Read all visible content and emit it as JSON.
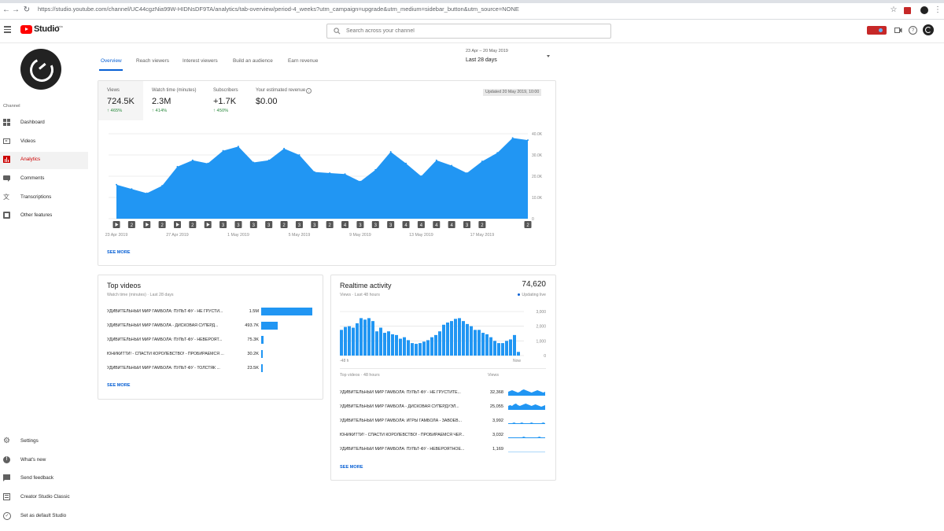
{
  "browser": {
    "url": "https://studio.youtube.com/channel/UC44cgzNia99W-HIDNsDF9TA/analytics/tab-overview/period-4_weeks?utm_campaign=upgrade&utm_medium=sidebar_button&utm_source=NONE"
  },
  "header": {
    "logo_text": "Studio",
    "logo_badge": "beta",
    "search_placeholder": "Search across your channel",
    "accent": "#ff0000"
  },
  "sidebar": {
    "section_label": "Channel",
    "items": [
      {
        "label": "Dashboard",
        "icon": "dashboard-icon"
      },
      {
        "label": "Videos",
        "icon": "videos-icon"
      },
      {
        "label": "Analytics",
        "icon": "analytics-icon"
      },
      {
        "label": "Comments",
        "icon": "comments-icon"
      },
      {
        "label": "Transcriptions",
        "icon": "transcriptions-icon"
      },
      {
        "label": "Other features",
        "icon": "other-features-icon"
      }
    ],
    "bottom_items": [
      {
        "label": "Settings",
        "icon": "settings-icon"
      },
      {
        "label": "What's new",
        "icon": "whats-new-icon"
      },
      {
        "label": "Send feedback",
        "icon": "feedback-icon"
      },
      {
        "label": "Creator Studio Classic",
        "icon": "classic-icon"
      },
      {
        "label": "Set as default Studio",
        "icon": "default-icon"
      }
    ]
  },
  "tabs": [
    "Overview",
    "Reach viewers",
    "Interest viewers",
    "Build an audience",
    "Earn revenue"
  ],
  "date_range": {
    "range": "23 Apr – 20 May 2019",
    "label": "Last 28 days"
  },
  "overview": {
    "updated": "Updated 20 May 2019, 10:00",
    "metrics": [
      {
        "label": "Views",
        "value": "724.5K",
        "change": "465%"
      },
      {
        "label": "Watch time (minutes)",
        "value": "2.3M",
        "change": "414%"
      },
      {
        "label": "Subscribers",
        "value": "+1.7K",
        "change": "450%"
      },
      {
        "label": "Your estimated revenue",
        "value": "$0.00",
        "change": ""
      }
    ],
    "see_more": "SEE MORE"
  },
  "chart_data": [
    {
      "type": "area",
      "title": "",
      "x": [
        "23 Apr",
        "24 Apr",
        "25 Apr",
        "26 Apr",
        "27 Apr",
        "28 Apr",
        "29 Apr",
        "30 Apr",
        "1 May",
        "2 May",
        "3 May",
        "4 May",
        "5 May",
        "6 May",
        "7 May",
        "8 May",
        "9 May",
        "10 May",
        "11 May",
        "12 May",
        "13 May",
        "14 May",
        "15 May",
        "16 May",
        "17 May",
        "18 May",
        "19 May",
        "20 May"
      ],
      "values": [
        16000,
        14000,
        12000,
        15500,
        24500,
        27500,
        26000,
        32000,
        34000,
        26500,
        27500,
        33000,
        30000,
        22000,
        21500,
        21000,
        17500,
        23000,
        31500,
        26000,
        20000,
        27500,
        25000,
        21500,
        27000,
        31000,
        38000,
        37000
      ],
      "x_tick_labels": [
        "23 Apr 2019",
        "27 Apr 2019",
        "1 May 2019",
        "5 May 2019",
        "9 May 2019",
        "13 May 2019",
        "17 May 2019"
      ],
      "y_tick_labels": [
        "0",
        "10.0K",
        "20.0K",
        "30.0K",
        "40.0K"
      ],
      "ylim": [
        0,
        40000
      ],
      "grid": true,
      "color": "#2196f3",
      "markers": [
        "play",
        "2",
        "play",
        "2",
        "play",
        "2",
        "play",
        "3",
        "3",
        "3",
        "3",
        "2",
        "3",
        "3",
        "2",
        "4",
        "3",
        "3",
        "3",
        "4",
        "4",
        "4",
        "4",
        "3",
        "2",
        "",
        "",
        "2"
      ]
    },
    {
      "type": "bar",
      "title": "Realtime activity",
      "x_tick_labels": [
        "-48 h",
        "Now"
      ],
      "y_tick_labels": [
        "0",
        "1,000",
        "2,000",
        "3,000"
      ],
      "ylim": [
        0,
        3000
      ],
      "color": "#2196f3",
      "values": [
        1750,
        1950,
        2000,
        1900,
        2200,
        2550,
        2450,
        2550,
        2350,
        1650,
        1900,
        1550,
        1650,
        1450,
        1400,
        1150,
        1250,
        1050,
        850,
        800,
        850,
        950,
        1050,
        1250,
        1400,
        1650,
        2100,
        2250,
        2350,
        2500,
        2550,
        2350,
        2150,
        2000,
        1750,
        1750,
        1550,
        1450,
        1250,
        1000,
        850,
        850,
        1000,
        1100,
        1400,
        250
      ]
    },
    {
      "type": "bar",
      "title": "Top videos",
      "categories": [
        "УДИВИТЕЛЬНЫЙ МИР ГАМБОЛА: ПУЛЬТ-ФУ - НЕ ГРУСТИ...",
        "УДИВИТЕЛЬНЫЙ МИР ГАМБОЛА - ДИСКОВАЯ СУПЕРД...",
        "УДИВИТЕЛЬНЫЙ МИР ГАМБОЛА: ПУЛЬТ-ФУ - НЕВЕРОЯТ...",
        "ЮНИКИТТИ! - СПАСТИ КОРОЛЕВСТВО! - ПРОБИРАЕМСЯ ...",
        "УДИВИТЕЛЬНЫЙ МИР ГАМБОЛА: ПУЛЬТ-ФУ - ТОЛСТЯК ..."
      ],
      "values": [
        1500000,
        493700,
        75300,
        30200,
        23500
      ]
    }
  ],
  "top_videos": {
    "title": "Top videos",
    "subtitle": "Watch time (minutes) · Last 28 days",
    "items": [
      {
        "title": "УДИВИТЕЛЬНЫЙ МИР ГАМБОЛА: ПУЛЬТ-ФУ - НЕ ГРУСТИ...",
        "value": "1.5M"
      },
      {
        "title": "УДИВИТЕЛЬНЫЙ МИР ГАМБОЛА - ДИСКОВАЯ СУПЕРД...",
        "value": "493.7K"
      },
      {
        "title": "УДИВИТЕЛЬНЫЙ МИР ГАМБОЛА: ПУЛЬТ-ФУ - НЕВЕРОЯТ...",
        "value": "75.3K"
      },
      {
        "title": "ЮНИКИТТИ! - СПАСТИ КОРОЛЕВСТВО! - ПРОБИРАЕМСЯ ...",
        "value": "30.2K"
      },
      {
        "title": "УДИВИТЕЛЬНЫЙ МИР ГАМБОЛА: ПУЛЬТ-ФУ - ТОЛСТЯК ...",
        "value": "23.5K"
      }
    ],
    "see_more": "SEE MORE"
  },
  "realtime": {
    "title": "Realtime activity",
    "subtitle": "Views · Last 48 hours",
    "total": "74,620",
    "live": "Updating live",
    "top_label": "Top videos · 48 hours",
    "views_label": "Views",
    "items": [
      {
        "title": "УДИВИТЕЛЬНЫЙ МИР ГАМБОЛА: ПУЛЬТ-ФУ - НЕ ГРУСТИТЕ...",
        "value": "32,368"
      },
      {
        "title": "УДИВИТЕЛЬНЫЙ МИР ГАМБОЛА - ДИСКОВАЯ СУПЕРДУЭЛ...",
        "value": "25,055"
      },
      {
        "title": "УДИВИТЕЛЬНЫЙ МИР ГАМБОЛА: ИГРЫ ГАМБОЛА - ЗАВОЕВ...",
        "value": "3,992"
      },
      {
        "title": "ЮНИКИТТИ! - СПАСТИ КОРОЛЕВСТВО! - ПРОБИРАЕМСЯ ЧЕР...",
        "value": "3,032"
      },
      {
        "title": "УДИВИТЕЛЬНЫЙ МИР ГАМБОЛА: ПУЛЬТ-ФУ - НЕВЕРОЯТНОЕ...",
        "value": "1,169"
      }
    ],
    "see_more": "SEE MORE"
  }
}
